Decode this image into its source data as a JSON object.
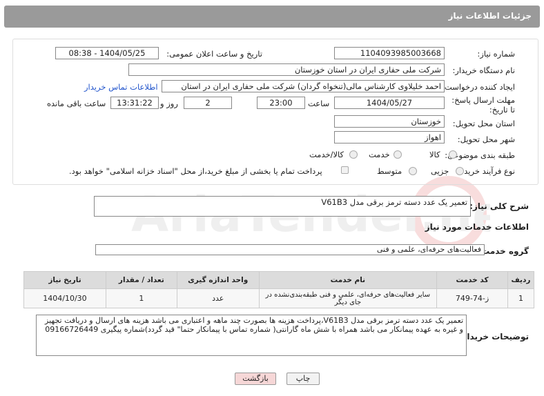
{
  "header": {
    "title": "جزئیات اطلاعات نیاز"
  },
  "fields": {
    "need_number_label": "شماره نیاز:",
    "need_number": "1104093985003668",
    "announce_label": "تاریخ و ساعت اعلان عمومی:",
    "announce_value": "1404/05/25 - 08:38",
    "buyer_org_label": "نام دستگاه خریدار:",
    "buyer_org": "شرکت ملی حفاری ایران در استان خوزستان",
    "creator_label": "ایجاد کننده درخواست:",
    "creator": "احمد خلیلاوی کارشناس مالی(تنخواه گردان) شرکت ملی حفاری ایران در استان",
    "contact_link": "اطلاعات تماس خریدار",
    "deadline_label": "مهلت ارسال پاسخ: تا تاریخ:",
    "deadline_date": "1404/05/27",
    "time_label": "ساعت",
    "deadline_time": "23:00",
    "days_value": "2",
    "days_label": "روز و",
    "remaining_time": "13:31:22",
    "remaining_label": "ساعت باقی مانده",
    "province_label": "استان محل تحویل:",
    "province": "خوزستان",
    "city_label": "شهر محل تحویل:",
    "city": "اهواز",
    "category_label": "طبقه بندی موضوعی:",
    "category_options": [
      "کالا",
      "خدمت",
      "کالا/خدمت"
    ],
    "purchase_type_label": "نوع فرآیند خرید :",
    "purchase_options": [
      "جزیی",
      "متوسط"
    ],
    "payment_note": "پرداخت تمام یا بخشی از مبلغ خرید،از محل \"اسناد خزانه اسلامی\" خواهد بود."
  },
  "summary": {
    "label": "شرح کلی نیاز:",
    "value": "تعمیر یک عدد دسته ترمز برقی مدل V61B3"
  },
  "services": {
    "title": "اطلاعات خدمات مورد نیاز",
    "group_label": "گروه خدمت:",
    "group_value": "فعالیت‌های حرفه‌ای، علمی و فنی",
    "columns": [
      "ردیف",
      "کد خدمت",
      "نام خدمت",
      "واحد اندازه گیری",
      "تعداد / مقدار",
      "تاریخ نیاز"
    ],
    "rows": [
      {
        "row": "1",
        "code": "ز-74-749",
        "name": "سایر فعالیت‌های حرفه‌ای، علمی و فنی طبقه‌بندی‌نشده در جای دیگر",
        "unit": "عدد",
        "qty": "1",
        "date": "1404/10/30"
      }
    ]
  },
  "buyer_desc": {
    "label": "توضیحات خریدار:",
    "value": "تعمیر یک عدد دسته ترمز برقی مدل V61B3،پرداخت هزینه ها بصورت چند ماهه و اعتباری می باشد هزینه های ارسال و دریافت تجهیز و غیره به عهده پیمانکار می باشد همراه با شش ماه گارانتی( شماره  تماس با پیمانکار حتما\" قید گردد)شماره پیگیری 09166726449"
  },
  "buttons": {
    "print": "چاپ",
    "back": "بازگشت"
  },
  "watermark": {
    "text": "AriaTender.neT"
  },
  "colors": {
    "header": "#9a9a9a",
    "link": "#2255cc",
    "back_btn": "#f6d7d7"
  }
}
